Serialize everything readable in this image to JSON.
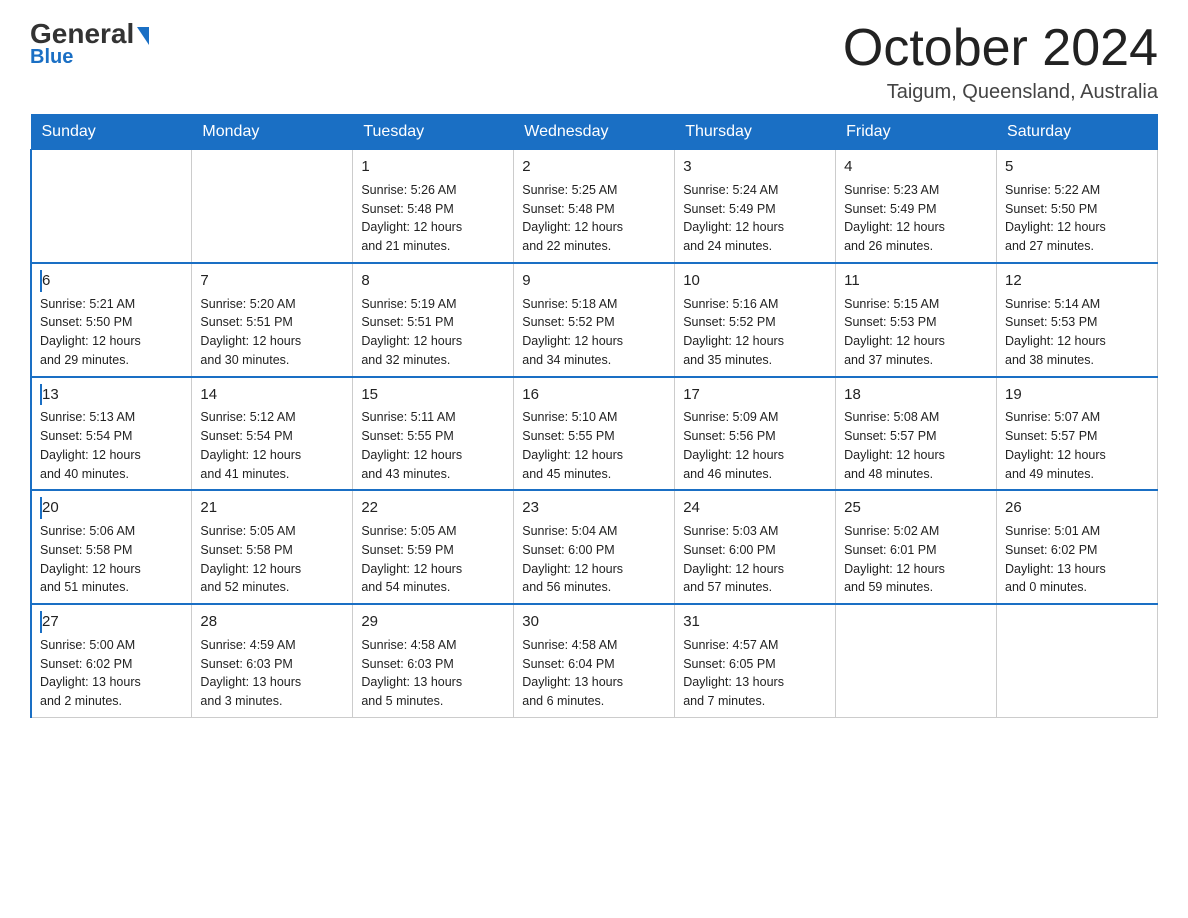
{
  "logo": {
    "part1": "General",
    "part2": "Blue"
  },
  "header": {
    "month": "October 2024",
    "location": "Taigum, Queensland, Australia"
  },
  "weekdays": [
    "Sunday",
    "Monday",
    "Tuesday",
    "Wednesday",
    "Thursday",
    "Friday",
    "Saturday"
  ],
  "weeks": [
    [
      {
        "day": "",
        "info": ""
      },
      {
        "day": "",
        "info": ""
      },
      {
        "day": "1",
        "info": "Sunrise: 5:26 AM\nSunset: 5:48 PM\nDaylight: 12 hours\nand 21 minutes."
      },
      {
        "day": "2",
        "info": "Sunrise: 5:25 AM\nSunset: 5:48 PM\nDaylight: 12 hours\nand 22 minutes."
      },
      {
        "day": "3",
        "info": "Sunrise: 5:24 AM\nSunset: 5:49 PM\nDaylight: 12 hours\nand 24 minutes."
      },
      {
        "day": "4",
        "info": "Sunrise: 5:23 AM\nSunset: 5:49 PM\nDaylight: 12 hours\nand 26 minutes."
      },
      {
        "day": "5",
        "info": "Sunrise: 5:22 AM\nSunset: 5:50 PM\nDaylight: 12 hours\nand 27 minutes."
      }
    ],
    [
      {
        "day": "6",
        "info": "Sunrise: 5:21 AM\nSunset: 5:50 PM\nDaylight: 12 hours\nand 29 minutes."
      },
      {
        "day": "7",
        "info": "Sunrise: 5:20 AM\nSunset: 5:51 PM\nDaylight: 12 hours\nand 30 minutes."
      },
      {
        "day": "8",
        "info": "Sunrise: 5:19 AM\nSunset: 5:51 PM\nDaylight: 12 hours\nand 32 minutes."
      },
      {
        "day": "9",
        "info": "Sunrise: 5:18 AM\nSunset: 5:52 PM\nDaylight: 12 hours\nand 34 minutes."
      },
      {
        "day": "10",
        "info": "Sunrise: 5:16 AM\nSunset: 5:52 PM\nDaylight: 12 hours\nand 35 minutes."
      },
      {
        "day": "11",
        "info": "Sunrise: 5:15 AM\nSunset: 5:53 PM\nDaylight: 12 hours\nand 37 minutes."
      },
      {
        "day": "12",
        "info": "Sunrise: 5:14 AM\nSunset: 5:53 PM\nDaylight: 12 hours\nand 38 minutes."
      }
    ],
    [
      {
        "day": "13",
        "info": "Sunrise: 5:13 AM\nSunset: 5:54 PM\nDaylight: 12 hours\nand 40 minutes."
      },
      {
        "day": "14",
        "info": "Sunrise: 5:12 AM\nSunset: 5:54 PM\nDaylight: 12 hours\nand 41 minutes."
      },
      {
        "day": "15",
        "info": "Sunrise: 5:11 AM\nSunset: 5:55 PM\nDaylight: 12 hours\nand 43 minutes."
      },
      {
        "day": "16",
        "info": "Sunrise: 5:10 AM\nSunset: 5:55 PM\nDaylight: 12 hours\nand 45 minutes."
      },
      {
        "day": "17",
        "info": "Sunrise: 5:09 AM\nSunset: 5:56 PM\nDaylight: 12 hours\nand 46 minutes."
      },
      {
        "day": "18",
        "info": "Sunrise: 5:08 AM\nSunset: 5:57 PM\nDaylight: 12 hours\nand 48 minutes."
      },
      {
        "day": "19",
        "info": "Sunrise: 5:07 AM\nSunset: 5:57 PM\nDaylight: 12 hours\nand 49 minutes."
      }
    ],
    [
      {
        "day": "20",
        "info": "Sunrise: 5:06 AM\nSunset: 5:58 PM\nDaylight: 12 hours\nand 51 minutes."
      },
      {
        "day": "21",
        "info": "Sunrise: 5:05 AM\nSunset: 5:58 PM\nDaylight: 12 hours\nand 52 minutes."
      },
      {
        "day": "22",
        "info": "Sunrise: 5:05 AM\nSunset: 5:59 PM\nDaylight: 12 hours\nand 54 minutes."
      },
      {
        "day": "23",
        "info": "Sunrise: 5:04 AM\nSunset: 6:00 PM\nDaylight: 12 hours\nand 56 minutes."
      },
      {
        "day": "24",
        "info": "Sunrise: 5:03 AM\nSunset: 6:00 PM\nDaylight: 12 hours\nand 57 minutes."
      },
      {
        "day": "25",
        "info": "Sunrise: 5:02 AM\nSunset: 6:01 PM\nDaylight: 12 hours\nand 59 minutes."
      },
      {
        "day": "26",
        "info": "Sunrise: 5:01 AM\nSunset: 6:02 PM\nDaylight: 13 hours\nand 0 minutes."
      }
    ],
    [
      {
        "day": "27",
        "info": "Sunrise: 5:00 AM\nSunset: 6:02 PM\nDaylight: 13 hours\nand 2 minutes."
      },
      {
        "day": "28",
        "info": "Sunrise: 4:59 AM\nSunset: 6:03 PM\nDaylight: 13 hours\nand 3 minutes."
      },
      {
        "day": "29",
        "info": "Sunrise: 4:58 AM\nSunset: 6:03 PM\nDaylight: 13 hours\nand 5 minutes."
      },
      {
        "day": "30",
        "info": "Sunrise: 4:58 AM\nSunset: 6:04 PM\nDaylight: 13 hours\nand 6 minutes."
      },
      {
        "day": "31",
        "info": "Sunrise: 4:57 AM\nSunset: 6:05 PM\nDaylight: 13 hours\nand 7 minutes."
      },
      {
        "day": "",
        "info": ""
      },
      {
        "day": "",
        "info": ""
      }
    ]
  ]
}
